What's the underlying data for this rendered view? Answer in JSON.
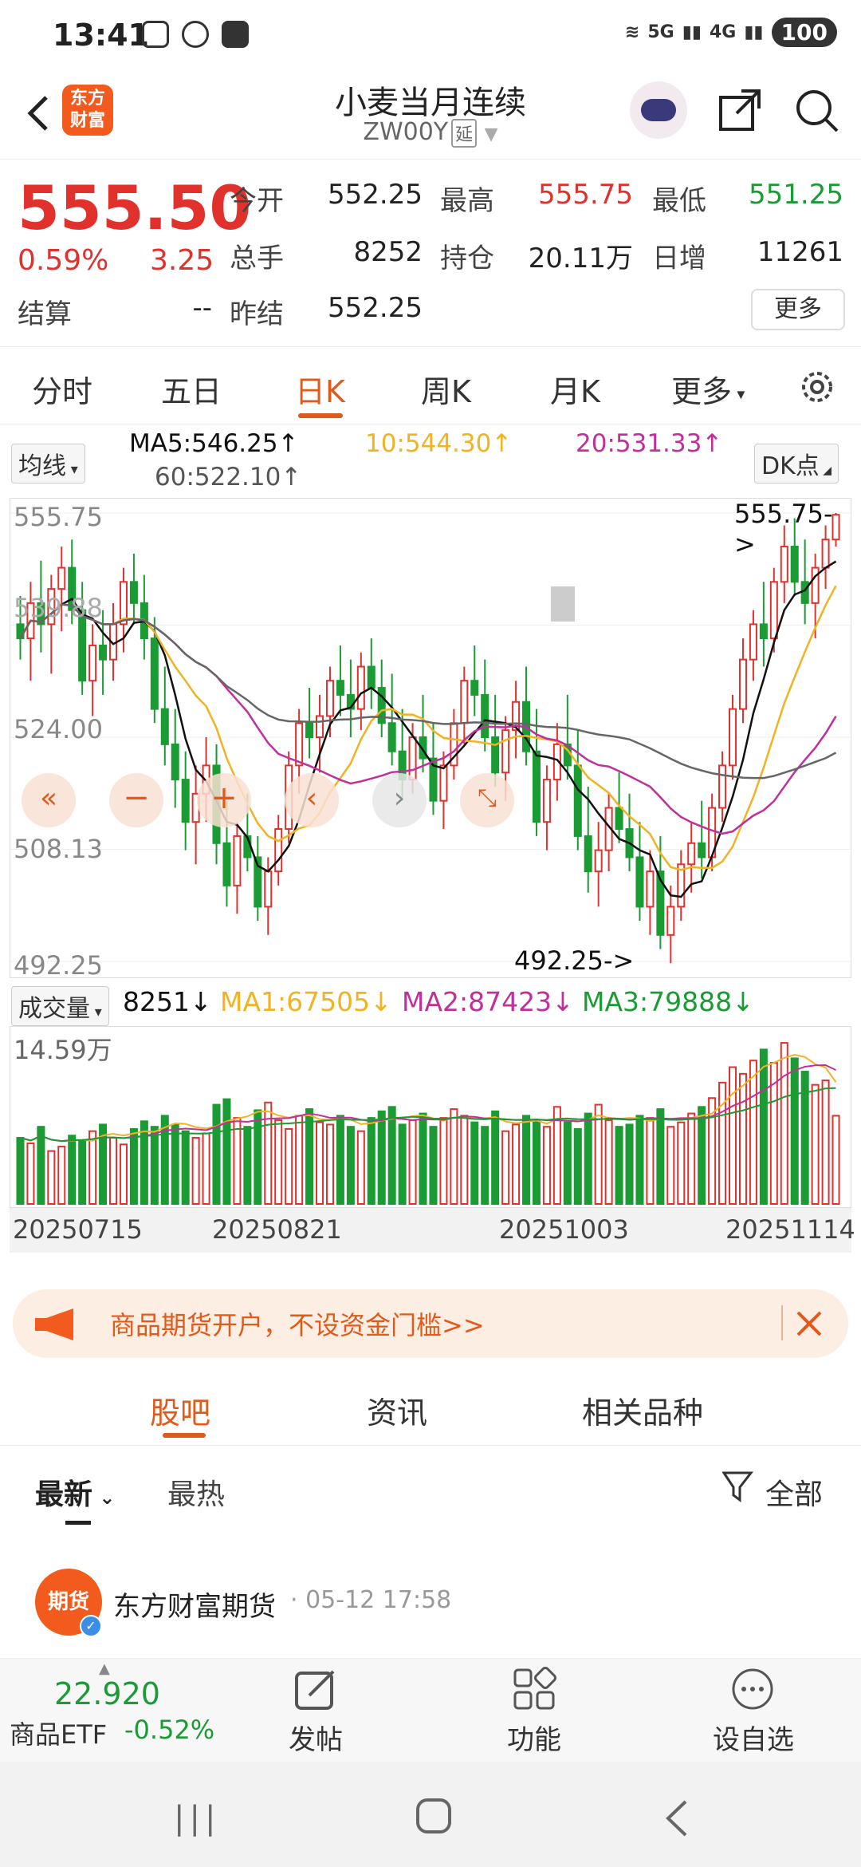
{
  "status_bar": {
    "time": "13:41",
    "battery": "100",
    "signal1": "5G",
    "signal2": "4G"
  },
  "header": {
    "title": "小麦当月连续",
    "code": "ZW00Y",
    "code_tag": "延",
    "logo_text": "东方财富"
  },
  "quote": {
    "price": "555.50",
    "change_pct": "0.59%",
    "change": "3.25",
    "open_label": "今开",
    "open": "552.25",
    "high_label": "最高",
    "high": "555.75",
    "low_label": "最低",
    "low": "551.25",
    "volume_label": "总手",
    "volume": "8252",
    "oi_label": "持仓",
    "oi": "20.11万",
    "daily_inc_label": "日增",
    "daily_inc": "11261",
    "settle_label": "结算",
    "settle": "--",
    "prev_settle_label": "昨结",
    "prev_settle": "552.25",
    "more": "更多"
  },
  "tabs": [
    {
      "label": "分时"
    },
    {
      "label": "五日"
    },
    {
      "label": "日K"
    },
    {
      "label": "周K"
    },
    {
      "label": "月K"
    },
    {
      "label": "更多"
    }
  ],
  "ma_row": {
    "select": "均线",
    "ma5": "MA5:546.25↑",
    "ma10": "10:544.30↑",
    "ma20": "20:531.33↑",
    "ma60": "60:522.10↑",
    "dk": "DK点"
  },
  "chart_labels": {
    "y_top": "555.75",
    "y_mid1": "539.88",
    "y_mid2": "524.00",
    "y_mid3": "508.13",
    "y_bottom": "492.25",
    "max_marker": "555.75->",
    "min_marker": "492.25->"
  },
  "volume_row": {
    "select": "成交量",
    "vol": "8251↓",
    "ma1": "MA1:67505↓",
    "ma2": "MA2:87423↓",
    "ma3": "MA3:79888↓",
    "y_top": "14.59万"
  },
  "dates": [
    "20250715",
    "20250821",
    "20251003",
    "20251114"
  ],
  "banner": {
    "text": "商品期货开户，不设资金门槛>>"
  },
  "subtabs": [
    {
      "label": "股吧"
    },
    {
      "label": "资讯"
    },
    {
      "label": "相关品种"
    }
  ],
  "filters": {
    "latest": "最新",
    "hot": "最热",
    "all": "全部"
  },
  "post": {
    "author": "东方财富期货",
    "time": "· 05-12 17:58",
    "avatar_text": "期货"
  },
  "bottombar": {
    "etf_price": "22.920",
    "etf_name": "商品ETF",
    "etf_change": "-0.52%",
    "post": "发帖",
    "func": "功能",
    "watch": "设自选"
  },
  "colors": {
    "red": "#e0312d",
    "green": "#1a9b34",
    "accent": "#e05a1a",
    "ma5": "#111111",
    "ma10": "#f0b323",
    "ma20": "#c0309a",
    "ma60": "#666666"
  },
  "chart_data": {
    "type": "candlestick",
    "ylim": [
      492.25,
      555.75
    ],
    "candles": [
      [
        540,
        544,
        535,
        538
      ],
      [
        538,
        546,
        532,
        543
      ],
      [
        543,
        549,
        536,
        540
      ],
      [
        540,
        547,
        533,
        545
      ],
      [
        545,
        551,
        539,
        548
      ],
      [
        548,
        552,
        540,
        542
      ],
      [
        542,
        546,
        530,
        532
      ],
      [
        532,
        540,
        527,
        537
      ],
      [
        537,
        542,
        530,
        535
      ],
      [
        535,
        543,
        532,
        540
      ],
      [
        540,
        548,
        536,
        546
      ],
      [
        546,
        550,
        540,
        543
      ],
      [
        543,
        547,
        535,
        538
      ],
      [
        538,
        541,
        526,
        528
      ],
      [
        528,
        534,
        520,
        523
      ],
      [
        523,
        528,
        514,
        518
      ],
      [
        518,
        522,
        508,
        512
      ],
      [
        512,
        520,
        506,
        516
      ],
      [
        516,
        524,
        512,
        520
      ],
      [
        520,
        523,
        506,
        509
      ],
      [
        509,
        515,
        500,
        503
      ],
      [
        503,
        512,
        499,
        510
      ],
      [
        510,
        516,
        505,
        507
      ],
      [
        507,
        510,
        498,
        500
      ],
      [
        500,
        507,
        496,
        505
      ],
      [
        505,
        513,
        503,
        511
      ],
      [
        511,
        522,
        509,
        520
      ],
      [
        520,
        528,
        516,
        526
      ],
      [
        526,
        531,
        521,
        524
      ],
      [
        524,
        530,
        519,
        527
      ],
      [
        527,
        534,
        524,
        532
      ],
      [
        532,
        537,
        527,
        530
      ],
      [
        530,
        535,
        524,
        528
      ],
      [
        528,
        536,
        525,
        534
      ],
      [
        534,
        538,
        528,
        531
      ],
      [
        531,
        535,
        524,
        526
      ],
      [
        526,
        533,
        520,
        522
      ],
      [
        522,
        528,
        515,
        518
      ],
      [
        518,
        526,
        516,
        524
      ],
      [
        524,
        530,
        519,
        521
      ],
      [
        521,
        526,
        513,
        515
      ],
      [
        515,
        522,
        511,
        520
      ],
      [
        520,
        528,
        518,
        526
      ],
      [
        526,
        534,
        523,
        532
      ],
      [
        532,
        537,
        527,
        530
      ],
      [
        530,
        535,
        522,
        524
      ],
      [
        524,
        530,
        517,
        519
      ],
      [
        519,
        527,
        515,
        525
      ],
      [
        525,
        532,
        521,
        529
      ],
      [
        529,
        534,
        520,
        522
      ],
      [
        522,
        528,
        510,
        512
      ],
      [
        512,
        520,
        508,
        518
      ],
      [
        518,
        526,
        515,
        523
      ],
      [
        523,
        530,
        518,
        520
      ],
      [
        520,
        525,
        508,
        510
      ],
      [
        510,
        517,
        502,
        505
      ],
      [
        505,
        512,
        500,
        508
      ],
      [
        508,
        516,
        505,
        514
      ],
      [
        514,
        519,
        509,
        511
      ],
      [
        511,
        516,
        505,
        507
      ],
      [
        507,
        512,
        498,
        500
      ],
      [
        500,
        508,
        496,
        505
      ],
      [
        505,
        510,
        494,
        496
      ],
      [
        496,
        503,
        492,
        500
      ],
      [
        500,
        508,
        498,
        506
      ],
      [
        506,
        512,
        502,
        509
      ],
      [
        509,
        515,
        504,
        507
      ],
      [
        507,
        516,
        505,
        514
      ],
      [
        514,
        522,
        512,
        520
      ],
      [
        520,
        530,
        518,
        528
      ],
      [
        528,
        538,
        526,
        535
      ],
      [
        535,
        542,
        532,
        540
      ],
      [
        540,
        546,
        534,
        538
      ],
      [
        538,
        548,
        536,
        546
      ],
      [
        546,
        554,
        543,
        551
      ],
      [
        551,
        555,
        544,
        546
      ],
      [
        546,
        552,
        540,
        543
      ],
      [
        543,
        550,
        538,
        548
      ],
      [
        548,
        554,
        545,
        552
      ],
      [
        552,
        555.75,
        551,
        555.5
      ]
    ],
    "volumes": [
      60,
      55,
      70,
      48,
      52,
      62,
      58,
      66,
      72,
      60,
      54,
      68,
      75,
      70,
      80,
      72,
      66,
      60,
      64,
      90,
      95,
      78,
      70,
      85,
      92,
      76,
      68,
      80,
      86,
      74,
      72,
      80,
      70,
      66,
      78,
      84,
      88,
      72,
      76,
      82,
      70,
      78,
      86,
      80,
      74,
      70,
      84,
      66,
      72,
      80,
      76,
      70,
      88,
      74,
      68,
      82,
      90,
      76,
      70,
      72,
      80,
      78,
      86,
      70,
      74,
      82,
      88,
      96,
      110,
      124,
      118,
      130,
      140,
      128,
      146,
      132,
      120,
      108,
      112,
      80
    ]
  }
}
